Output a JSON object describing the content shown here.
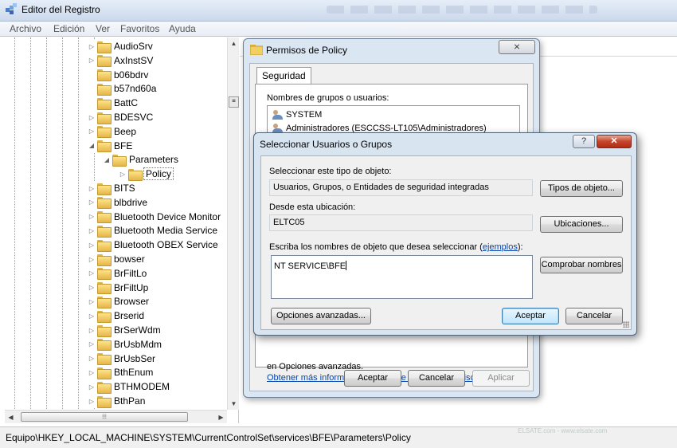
{
  "window": {
    "title": "Editor del Registro",
    "menu": [
      "Archivo",
      "Edición",
      "Ver",
      "Favoritos",
      "Ayuda"
    ],
    "status_path": "Equipo\\HKEY_LOCAL_MACHINE\\SYSTEM\\CurrentControlSet\\services\\BFE\\Parameters\\Policy",
    "watermark": "ELSATE.com - www.elsate.com"
  },
  "tree": {
    "items": [
      {
        "label": "AudioSrv",
        "expand": "▷"
      },
      {
        "label": "AxInstSV",
        "expand": "▷"
      },
      {
        "label": "b06bdrv",
        "expand": ""
      },
      {
        "label": "b57nd60a",
        "expand": ""
      },
      {
        "label": "BattC",
        "expand": ""
      },
      {
        "label": "BDESVC",
        "expand": "▷"
      },
      {
        "label": "Beep",
        "expand": "▷"
      },
      {
        "label": "BFE",
        "expand": "◢"
      },
      {
        "label": "Parameters",
        "expand": "◢"
      },
      {
        "label": "Policy",
        "expand": "▷"
      },
      {
        "label": "BITS",
        "expand": "▷"
      },
      {
        "label": "blbdrive",
        "expand": "▷"
      },
      {
        "label": "Bluetooth Device Monitor",
        "expand": "▷"
      },
      {
        "label": "Bluetooth Media Service",
        "expand": "▷"
      },
      {
        "label": "Bluetooth OBEX Service",
        "expand": "▷"
      },
      {
        "label": "bowser",
        "expand": "▷"
      },
      {
        "label": "BrFiltLo",
        "expand": "▷"
      },
      {
        "label": "BrFiltUp",
        "expand": "▷"
      },
      {
        "label": "Browser",
        "expand": "▷"
      },
      {
        "label": "Brserid",
        "expand": "▷"
      },
      {
        "label": "BrSerWdm",
        "expand": "▷"
      },
      {
        "label": "BrUsbMdm",
        "expand": "▷"
      },
      {
        "label": "BrUsbSer",
        "expand": "▷"
      },
      {
        "label": "BthEnum",
        "expand": "▷"
      },
      {
        "label": "BTHMODEM",
        "expand": "▷"
      },
      {
        "label": "BthPan",
        "expand": "▷"
      }
    ]
  },
  "permisos": {
    "title": "Permisos de Policy",
    "close": "⨯",
    "tab": "Seguridad",
    "group_label": "Nombres de grupos o usuarios:",
    "users": [
      "SYSTEM",
      "Administradores (ESCCSS-LT105\\Administradores)"
    ],
    "hint": "en Opciones avanzadas.",
    "link": "Obtener más información acerca de control y permisos de acceso",
    "buttons": {
      "ok": "Aceptar",
      "cancel": "Cancelar",
      "apply": "Aplicar"
    }
  },
  "seleccionar": {
    "title": "Seleccionar Usuarios o Grupos",
    "help": "?",
    "close": "✕",
    "type_label": "Seleccionar este tipo de objeto:",
    "type_value": "Usuarios, Grupos, o Entidades de seguridad integradas",
    "type_button": "Tipos de objeto...",
    "loc_label": "Desde esta ubicación:",
    "loc_value": "ELTC05",
    "loc_button": "Ubicaciones...",
    "names_label_prefix": "Escriba los nombres de objeto que desea seleccionar (",
    "names_link": "ejemplos",
    "names_label_suffix": "):",
    "names_value": "NT SERVICE\\BFE",
    "check_button": "Comprobar nombres",
    "advanced_button": "Opciones avanzadas...",
    "ok_button": "Aceptar",
    "cancel_button": "Cancelar"
  },
  "colors": {
    "link": "#0645ad",
    "dialog_frame": "#d9e4f1",
    "close_red": "#c6452c"
  }
}
